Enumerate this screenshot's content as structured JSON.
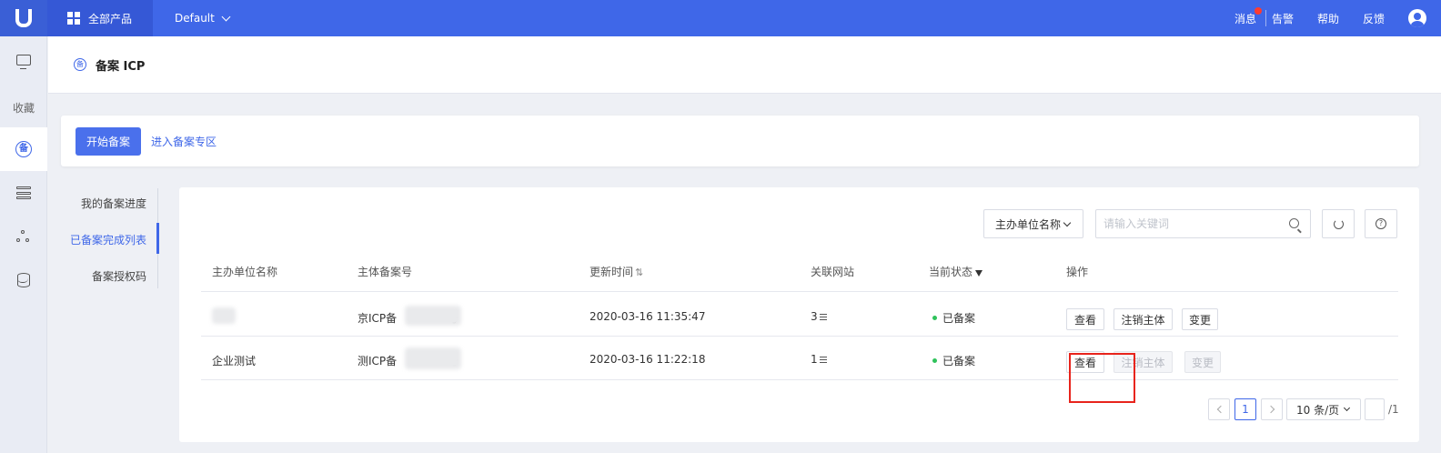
{
  "topbar": {
    "all_products": "全部产品",
    "project": "Default",
    "messages": "消息",
    "alerts": "告警",
    "help": "帮助",
    "feedback": "反馈"
  },
  "sidenav": {
    "favorites": "收藏"
  },
  "header": {
    "title": "备案 ICP",
    "icon_char": "备"
  },
  "actions": {
    "start": "开始备案",
    "zone_link": "进入备案专区"
  },
  "subnav": {
    "items": [
      "我的备案进度",
      "已备案完成列表",
      "备案授权码"
    ]
  },
  "toolbar": {
    "filter_select": "主办单位名称",
    "search_placeholder": "请输入关键词",
    "help_char": "?"
  },
  "table": {
    "headers": [
      "主办单位名称",
      "主体备案号",
      "更新时间",
      "关联网站",
      "当前状态",
      "操作"
    ],
    "rows": [
      {
        "org": "",
        "record_prefix": "京ICP备",
        "record_suffix": "号",
        "updated": "2020-03-16 11:35:47",
        "sites": "3",
        "status": "已备案",
        "view": "查看",
        "cancel": "注销主体",
        "change": "变更"
      },
      {
        "org": "企业测试",
        "record_prefix": "测ICP备",
        "record_suffix": "号",
        "updated": "2020-03-16 11:22:18",
        "sites": "1",
        "status": "已备案",
        "view": "查看",
        "cancel": "注销主体",
        "change": "变更"
      }
    ]
  },
  "pager": {
    "current": "1",
    "page_size": "10 条/页",
    "total": "/1"
  },
  "colors": {
    "brand": "#3f67e8",
    "status_ok": "#2fc25b",
    "highlight": "#e8241c"
  }
}
